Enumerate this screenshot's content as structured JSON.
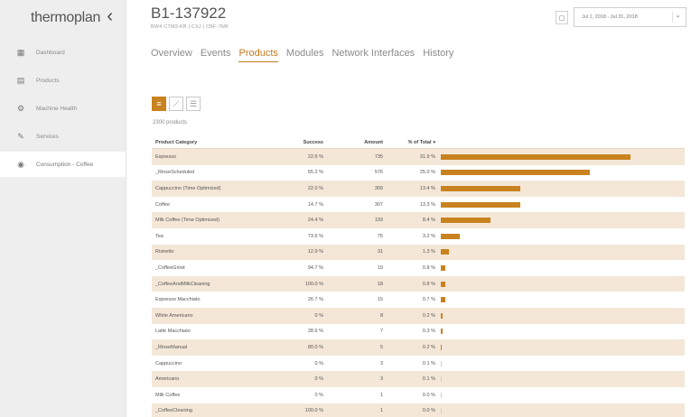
{
  "sidebar": {
    "logo": "thermoplan",
    "collapse": "‹",
    "items": [
      {
        "label": "Dashboard",
        "icon": "dashboard-icon",
        "glyph": "▦"
      },
      {
        "label": "Products",
        "icon": "products-icon",
        "glyph": "▤"
      },
      {
        "label": "Machine Health",
        "icon": "machine-health-icon",
        "glyph": "⚙"
      },
      {
        "label": "Services",
        "icon": "services-icon",
        "glyph": "✎"
      },
      {
        "label": "Consumption - Coffee",
        "icon": "coffee-consumption-icon",
        "glyph": "◉"
      }
    ]
  },
  "header": {
    "device_id": "B1-137922",
    "device_sub": "BW4 CTM2-KB  |  CXJ  |  CBF-TMF",
    "calendar_glyph": "▢",
    "date_range": "Jul 1, 2018 - Jul 31, 2018",
    "date_caret": "⌄"
  },
  "tabs": [
    {
      "label": "Overview"
    },
    {
      "label": "Events"
    },
    {
      "label": "Products"
    },
    {
      "label": "Modules"
    },
    {
      "label": "Network Interfaces"
    },
    {
      "label": "History"
    }
  ],
  "view_toggles": {
    "bar": "≡",
    "line": "⟋",
    "list": "☰"
  },
  "product_count": "2300 products",
  "table": {
    "headers": {
      "category": "Product Category",
      "success": "Success",
      "amount": "Amount",
      "pct": "% of Total",
      "sort": "▾"
    },
    "rows": [
      {
        "category": "Espresso",
        "success": "22.6 %",
        "amount": "735",
        "pct": "31.9 %",
        "share": 31.9
      },
      {
        "category": "_RinseScheduled",
        "success": "55.2 %",
        "amount": "576",
        "pct": "25.0 %",
        "share": 25.0
      },
      {
        "category": "Cappuccino (Time Optimized)",
        "success": "22.0 %",
        "amount": "309",
        "pct": "13.4 %",
        "share": 13.4
      },
      {
        "category": "Coffee",
        "success": "14.7 %",
        "amount": "307",
        "pct": "13.3 %",
        "share": 13.3
      },
      {
        "category": "Milk Coffee (Time Optimized)",
        "success": "24.4 %",
        "amount": "193",
        "pct": "8.4 %",
        "share": 8.4
      },
      {
        "category": "Tea",
        "success": "73.6 %",
        "amount": "75",
        "pct": "3.2 %",
        "share": 3.2
      },
      {
        "category": "Ristretto",
        "success": "12.9 %",
        "amount": "31",
        "pct": "1.3 %",
        "share": 1.3
      },
      {
        "category": "_CoffeeGrind",
        "success": "94.7 %",
        "amount": "19",
        "pct": "0.8 %",
        "share": 0.8
      },
      {
        "category": "_CoffeeAndMilkCleaning",
        "success": "100.0 %",
        "amount": "18",
        "pct": "0.8 %",
        "share": 0.8
      },
      {
        "category": "Espresso Macchiato",
        "success": "26.7 %",
        "amount": "15",
        "pct": "0.7 %",
        "share": 0.7
      },
      {
        "category": "White Americano",
        "success": "0 %",
        "amount": "8",
        "pct": "0.2 %",
        "share": 0.35
      },
      {
        "category": "Latte Macchiato",
        "success": "28.6 %",
        "amount": "7",
        "pct": "0.3 %",
        "share": 0.3
      },
      {
        "category": "_RinseManual",
        "success": "80.0 %",
        "amount": "5",
        "pct": "0.2 %",
        "share": 0.2
      },
      {
        "category": "Cappuccino",
        "success": "0 %",
        "amount": "3",
        "pct": "0.1 %",
        "share": 0.13
      },
      {
        "category": "Americano",
        "success": "0 %",
        "amount": "3",
        "pct": "0.1 %",
        "share": 0.13
      },
      {
        "category": "Milk Coffee",
        "success": "0 %",
        "amount": "1",
        "pct": "0.0 %",
        "share": 0.05
      },
      {
        "category": "_CoffeeCleaning",
        "success": "100.0 %",
        "amount": "1",
        "pct": "0.0 %",
        "share": 0.05
      }
    ]
  },
  "colors": {
    "accent": "#c8821f",
    "row_stripe": "#f4e7d7"
  }
}
